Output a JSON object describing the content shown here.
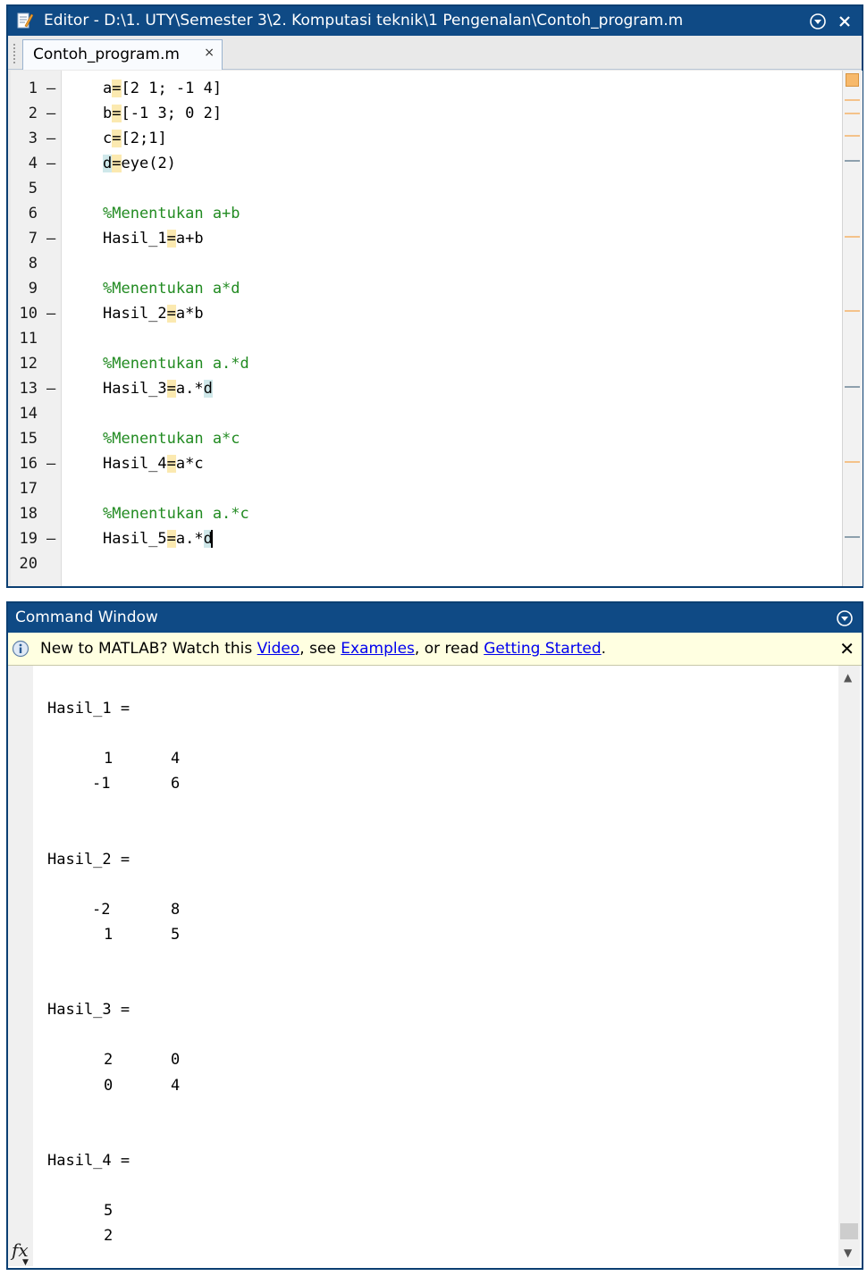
{
  "editor": {
    "title": "Editor - D:\\1. UTY\\Semester 3\\2. Komputasi teknik\\1 Pengenalan\\Contoh_program.m",
    "tab_label": "Contoh_program.m",
    "tab_close": "×",
    "close_glyph": "✕",
    "lines": [
      {
        "n": "1",
        "dash": true,
        "kind": "code",
        "segments": [
          {
            "t": "a"
          },
          {
            "t": "=",
            "hl": "eq"
          },
          {
            "t": "[2 1; -1 4]"
          }
        ]
      },
      {
        "n": "2",
        "dash": true,
        "kind": "code",
        "segments": [
          {
            "t": "b"
          },
          {
            "t": "=",
            "hl": "eq"
          },
          {
            "t": "[-1 3; 0 2]"
          }
        ]
      },
      {
        "n": "3",
        "dash": true,
        "kind": "code",
        "segments": [
          {
            "t": "c"
          },
          {
            "t": "=",
            "hl": "eq"
          },
          {
            "t": "[2;1]"
          }
        ]
      },
      {
        "n": "4",
        "dash": true,
        "kind": "code",
        "segments": [
          {
            "t": "d",
            "hl": "var"
          },
          {
            "t": "=",
            "hl": "eq"
          },
          {
            "t": "eye(2)"
          }
        ]
      },
      {
        "n": "5",
        "dash": false,
        "kind": "code",
        "segments": []
      },
      {
        "n": "6",
        "dash": false,
        "kind": "comment",
        "segments": [
          {
            "t": "%Menentukan a+b"
          }
        ]
      },
      {
        "n": "7",
        "dash": true,
        "kind": "code",
        "segments": [
          {
            "t": "Hasil_1"
          },
          {
            "t": "=",
            "hl": "eq"
          },
          {
            "t": "a+b"
          }
        ]
      },
      {
        "n": "8",
        "dash": false,
        "kind": "code",
        "segments": []
      },
      {
        "n": "9",
        "dash": false,
        "kind": "comment",
        "segments": [
          {
            "t": "%Menentukan a*d"
          }
        ]
      },
      {
        "n": "10",
        "dash": true,
        "kind": "code",
        "segments": [
          {
            "t": "Hasil_2"
          },
          {
            "t": "=",
            "hl": "eq"
          },
          {
            "t": "a*b"
          }
        ]
      },
      {
        "n": "11",
        "dash": false,
        "kind": "code",
        "segments": []
      },
      {
        "n": "12",
        "dash": false,
        "kind": "comment",
        "segments": [
          {
            "t": "%Menentukan a.*d"
          }
        ]
      },
      {
        "n": "13",
        "dash": true,
        "kind": "code",
        "segments": [
          {
            "t": "Hasil_3"
          },
          {
            "t": "=",
            "hl": "eq"
          },
          {
            "t": "a.*"
          },
          {
            "t": "d",
            "hl": "var"
          }
        ]
      },
      {
        "n": "14",
        "dash": false,
        "kind": "code",
        "segments": []
      },
      {
        "n": "15",
        "dash": false,
        "kind": "comment",
        "segments": [
          {
            "t": "%Menentukan a*c"
          }
        ]
      },
      {
        "n": "16",
        "dash": true,
        "kind": "code",
        "segments": [
          {
            "t": "Hasil_4"
          },
          {
            "t": "=",
            "hl": "eq"
          },
          {
            "t": "a*c"
          }
        ]
      },
      {
        "n": "17",
        "dash": false,
        "kind": "code",
        "segments": []
      },
      {
        "n": "18",
        "dash": false,
        "kind": "comment",
        "segments": [
          {
            "t": "%Menentukan a.*c"
          }
        ]
      },
      {
        "n": "19",
        "dash": true,
        "kind": "code",
        "caret": true,
        "segments": [
          {
            "t": "Hasil_5"
          },
          {
            "t": "=",
            "hl": "eq"
          },
          {
            "t": "a.*"
          },
          {
            "t": "d",
            "hl": "var"
          }
        ]
      },
      {
        "n": "20",
        "dash": false,
        "kind": "code",
        "segments": []
      }
    ]
  },
  "command_window": {
    "title": "Command Window",
    "notice": {
      "prefix": "New to MATLAB? Watch this ",
      "link1": "Video",
      "mid1": ", see ",
      "link2": "Examples",
      "mid2": ", or read ",
      "link3": "Getting Started",
      "suffix": ".",
      "close": "✕"
    },
    "output": [
      {
        "text": "Hasil_1 =",
        "col": 0,
        "row": 0
      },
      {
        "text": "1",
        "col": 2,
        "row": 2
      },
      {
        "text": "4",
        "col": 5,
        "row": 2
      },
      {
        "text": "-1",
        "col": 1,
        "row": 3
      },
      {
        "text": "6",
        "col": 5,
        "row": 3
      },
      {
        "text": "Hasil_2 =",
        "col": 0,
        "row": 6
      },
      {
        "text": "-2",
        "col": 1,
        "row": 8
      },
      {
        "text": "8",
        "col": 5,
        "row": 8
      },
      {
        "text": "1",
        "col": 2,
        "row": 9
      },
      {
        "text": "5",
        "col": 5,
        "row": 9
      },
      {
        "text": "Hasil_3 =",
        "col": 0,
        "row": 12
      },
      {
        "text": "2",
        "col": 2,
        "row": 14
      },
      {
        "text": "0",
        "col": 5,
        "row": 14
      },
      {
        "text": "0",
        "col": 2,
        "row": 15
      },
      {
        "text": "4",
        "col": 5,
        "row": 15
      },
      {
        "text": "Hasil_4 =",
        "col": 0,
        "row": 18
      },
      {
        "text": "5",
        "col": 2,
        "row": 20
      },
      {
        "text": "2",
        "col": 2,
        "row": 21
      }
    ],
    "fx": "fx"
  }
}
